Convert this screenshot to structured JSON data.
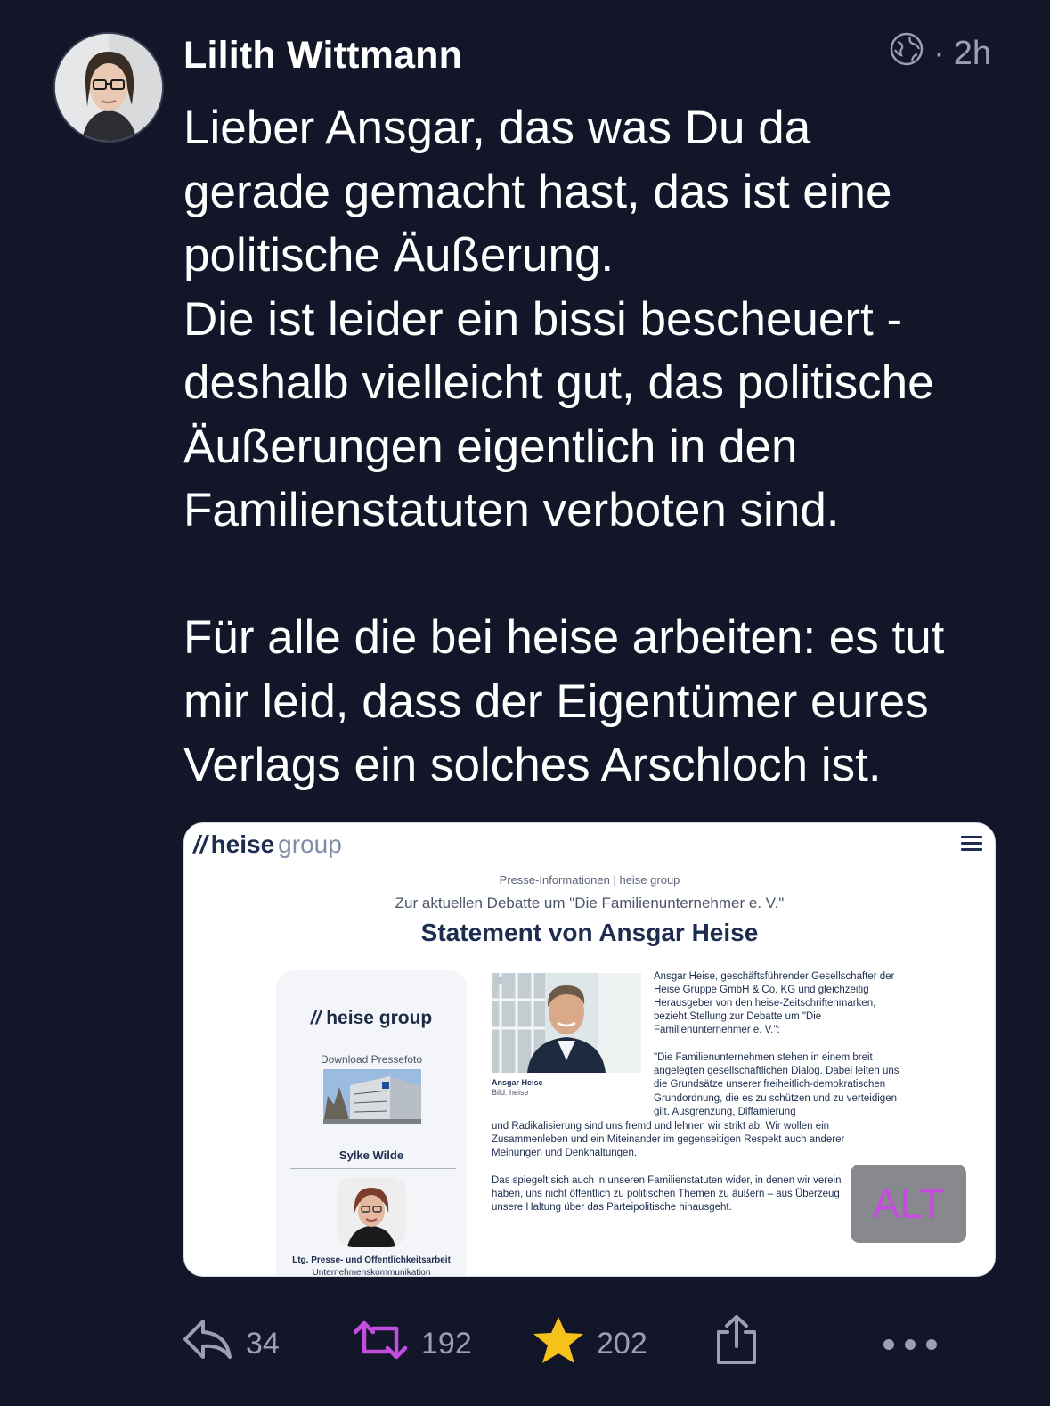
{
  "post": {
    "author": "Lilith Wittmann",
    "time": "2h",
    "separator": "·",
    "visibility_icon": "globe-icon",
    "text": "Lieber Ansgar, das was Du da\ngerade gemacht hast, das ist eine\npolitische Äußerung.\nDie ist leider ein bissi bescheuert -\ndeshalb vielleicht gut, das politische\nÄußerungen eigentlich in den\nFamilienstatuten verboten sind.\n\nFür alle die bei heise arbeiten: es tut\nmir leid, dass der Eigentümer eures\nVerlags ein solches Arschloch ist."
  },
  "attachment": {
    "logo_main": "heise",
    "logo_sub": "group",
    "press_info": "Presse-Informationen | heise group",
    "debate": "Zur aktuellen Debatte um \"Die Familienunternehmer e. V.\"",
    "headline": "Statement von Ansgar Heise",
    "sidebar": {
      "logo": "heise group",
      "download": "Download Pressefoto",
      "contact_name": "Sylke Wilde",
      "role": "Ltg. Presse- und Öffentlichkeitsarbeit",
      "unit": "Unternehmenskommunikation"
    },
    "photo_caption_name": "Ansgar Heise",
    "photo_caption_credit": "Bild: heise",
    "intro": "Ansgar Heise, geschäftsführender Gesellschafter der Heise Gruppe GmbH & Co. KG und gleichzeitig Herausgeber von den heise-Zeitschriftenmarken, bezieht Stellung zur Debatte um \"Die Familienunternehmer e. V.\":",
    "quote_narrow": "\"Die Familienunternehmen stehen in einem breit angelegten gesellschaftlichen Dialog. Dabei leiten uns die Grundsätze unserer freiheitlich-demokratischen Grundordnung, die es zu schützen und zu verteidigen gilt. Ausgrenzung, Diffamierung",
    "quote_wide": "und Radikalisierung sind uns fremd und lehnen wir strikt ab. Wir wollen ein Zusammenleben und ein Miteinander im gegenseitigen Respekt auch anderer Meinungen und Denkhaltungen.",
    "para2": "Das spiegelt sich auch in unseren Familienstatuten wider, in denen wir verein haben, uns nicht öffentlich zu politischen Themen zu äußern – aus Überzeug unsere Haltung über das Parteipolitische hinausgeht.",
    "alt_badge": "ALT"
  },
  "actions": {
    "reply_count": "34",
    "boost_count": "192",
    "favourite_count": "202",
    "colors": {
      "boost": "#c44cdf",
      "star": "#f4c21b",
      "muted": "#9a9fb3"
    }
  }
}
